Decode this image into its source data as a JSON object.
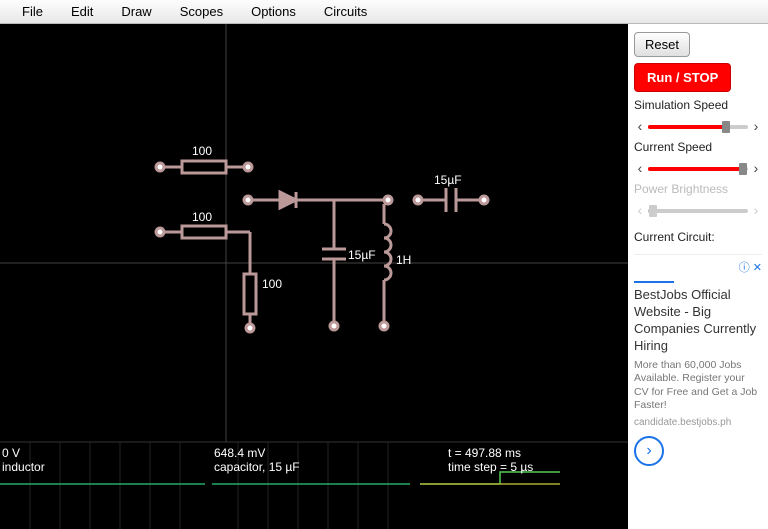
{
  "menu": {
    "file": "File",
    "edit": "Edit",
    "draw": "Draw",
    "scopes": "Scopes",
    "options": "Options",
    "circuits": "Circuits"
  },
  "sidebar": {
    "reset": "Reset",
    "runstop": "Run / STOP",
    "sim_speed_label": "Simulation Speed",
    "current_speed_label": "Current Speed",
    "power_brightness_label": "Power Brightness",
    "current_circuit_label": "Current Circuit:",
    "sliders": {
      "sim_speed": 78,
      "current_speed": 95,
      "power_brightness": 5
    }
  },
  "circuit": {
    "components": {
      "r1": "100",
      "r2": "100",
      "r3": "100",
      "c1": "15µF",
      "c2": "15µF",
      "l1": "1H"
    }
  },
  "scope": {
    "left": {
      "line1": "0 V",
      "line2": "inductor"
    },
    "mid": {
      "line1": "648.4 mV",
      "line2": "capacitor, 15 µF"
    },
    "right": {
      "line1": "t = 497.88 ms",
      "line2": "time step = 5 µs"
    }
  },
  "ad": {
    "info": "ⓘ ✕",
    "title": "BestJobs Official Website - Big Companies Currently Hiring",
    "body": "More than 60,000 Jobs Available. Register your CV for Free and Get a Job Faster!",
    "url": "candidate.bestjobs.ph"
  }
}
